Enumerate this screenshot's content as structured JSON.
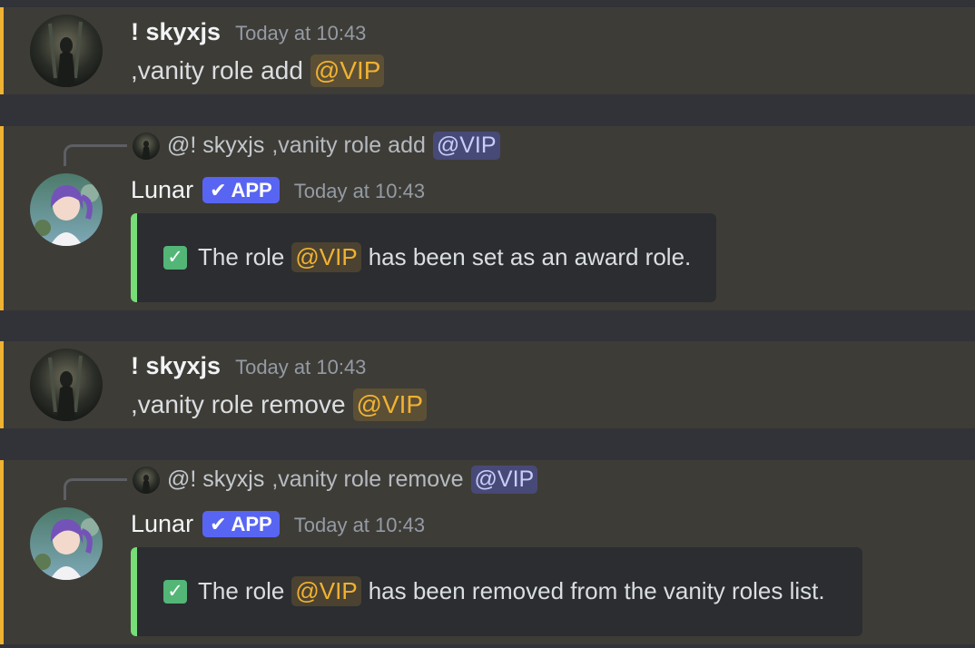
{
  "colors": {
    "background": "#313338",
    "highlight_bg": "#3e3c37",
    "highlight_bar": "#f0b232",
    "embed_bg": "#2b2d31",
    "embed_bar": "#77dd77",
    "app_badge": "#5865f2",
    "role_mention": "#f0b232"
  },
  "messages": [
    {
      "username": "! skyxjs",
      "timestamp": "Today at 10:43",
      "text": ",vanity role add",
      "mention": "@VIP"
    },
    {
      "reply": {
        "user": "@! skyxjs",
        "text": ",vanity role add",
        "mention": "@VIP"
      },
      "username": "Lunar",
      "badge": "APP",
      "badge_icon": "check-icon",
      "timestamp": "Today at 10:43",
      "embed": {
        "icon": "white-check-mark-icon",
        "prefix": "The role",
        "role": "@VIP",
        "suffix": "has been set as an award role."
      }
    },
    {
      "username": "! skyxjs",
      "timestamp": "Today at 10:43",
      "text": ",vanity role remove",
      "mention": "@VIP"
    },
    {
      "reply": {
        "user": "@! skyxjs",
        "text": ",vanity role remove",
        "mention": "@VIP"
      },
      "username": "Lunar",
      "badge": "APP",
      "badge_icon": "check-icon",
      "timestamp": "Today at 10:43",
      "embed": {
        "icon": "white-check-mark-icon",
        "prefix": "The role",
        "role": "@VIP",
        "suffix": "has been removed from the vanity roles list."
      }
    }
  ]
}
